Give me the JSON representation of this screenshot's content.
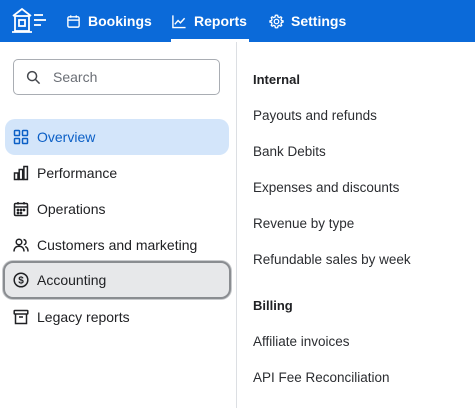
{
  "topbar": {
    "logo_icon": "store-logo-icon",
    "tabs": [
      {
        "label": "Bookings",
        "icon": "calendar-icon"
      },
      {
        "label": "Reports",
        "icon": "line-chart-icon",
        "active": true
      },
      {
        "label": "Settings",
        "icon": "gear-icon"
      }
    ]
  },
  "sidebar": {
    "search": {
      "placeholder": "Search",
      "icon": "search-icon"
    },
    "items": [
      {
        "label": "Overview",
        "icon": "grid-icon",
        "state": "active"
      },
      {
        "label": "Performance",
        "icon": "bar-chart-icon"
      },
      {
        "label": "Operations",
        "icon": "calendar-icon"
      },
      {
        "label": "Customers and marketing",
        "icon": "people-icon"
      },
      {
        "label": "Accounting",
        "icon": "dollar-circle-icon",
        "state": "focused"
      },
      {
        "label": "Legacy reports",
        "icon": "archive-icon"
      }
    ]
  },
  "main": {
    "sections": [
      {
        "heading": "Internal",
        "links": [
          "Payouts and refunds",
          "Bank Debits",
          "Expenses and discounts",
          "Revenue by type",
          "Refundable sales by week"
        ]
      },
      {
        "heading": "Billing",
        "links": [
          "Affiliate invoices",
          "API Fee Reconciliation"
        ]
      }
    ]
  },
  "colors": {
    "topbar": "#0b6ad9",
    "active_item_bg": "#d3e5fa",
    "active_item_text": "#0b5fc6",
    "focused_item_bg": "#e7e8ea"
  }
}
